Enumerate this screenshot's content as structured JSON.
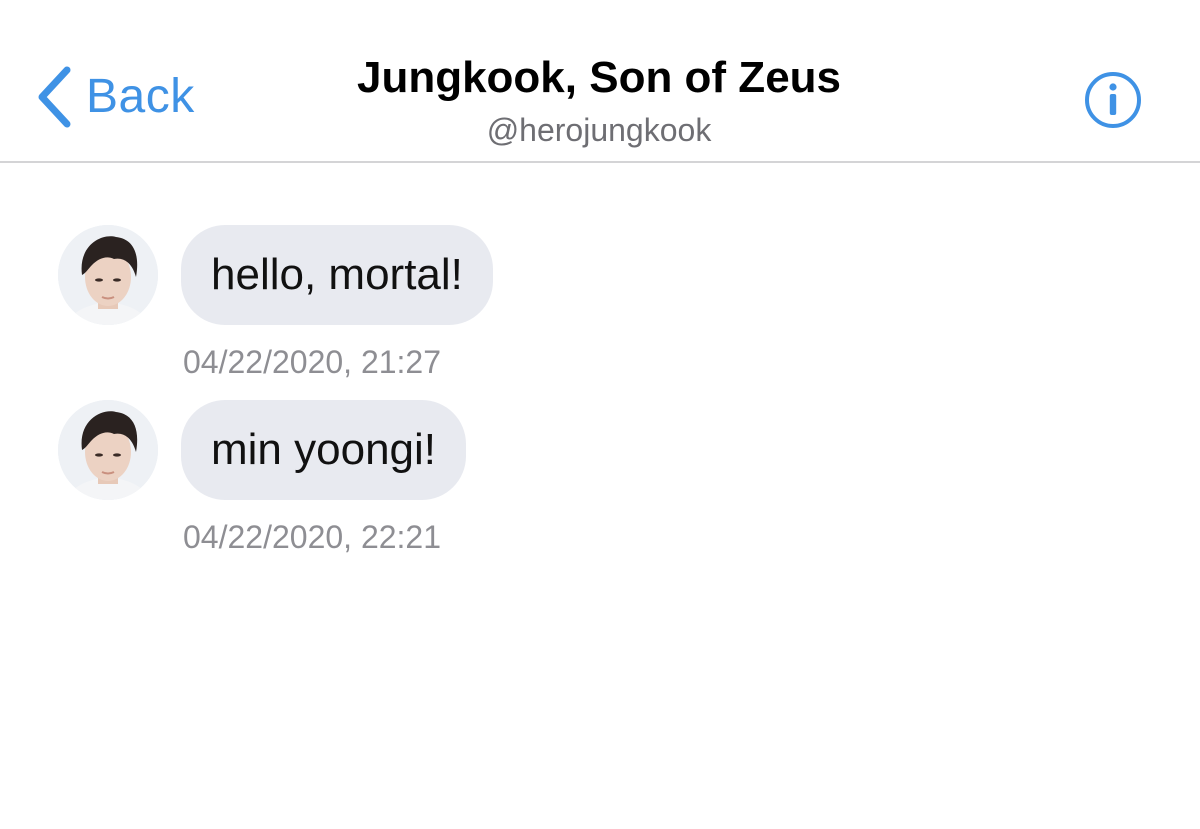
{
  "header": {
    "back_label": "Back",
    "title": "Jungkook, Son of Zeus",
    "handle": "@herojungkook",
    "back_icon": "chevron-left-icon",
    "info_icon": "info-icon"
  },
  "messages": [
    {
      "text": "hello, mortal!",
      "timestamp": "04/22/2020, 21:27"
    },
    {
      "text": "min yoongi!",
      "timestamp": "04/22/2020, 22:21"
    }
  ],
  "colors": {
    "accent": "#3f92e5",
    "bubble": "#e8eaf0",
    "timestamp": "#8e8e93",
    "divider": "#d4d4d6"
  }
}
